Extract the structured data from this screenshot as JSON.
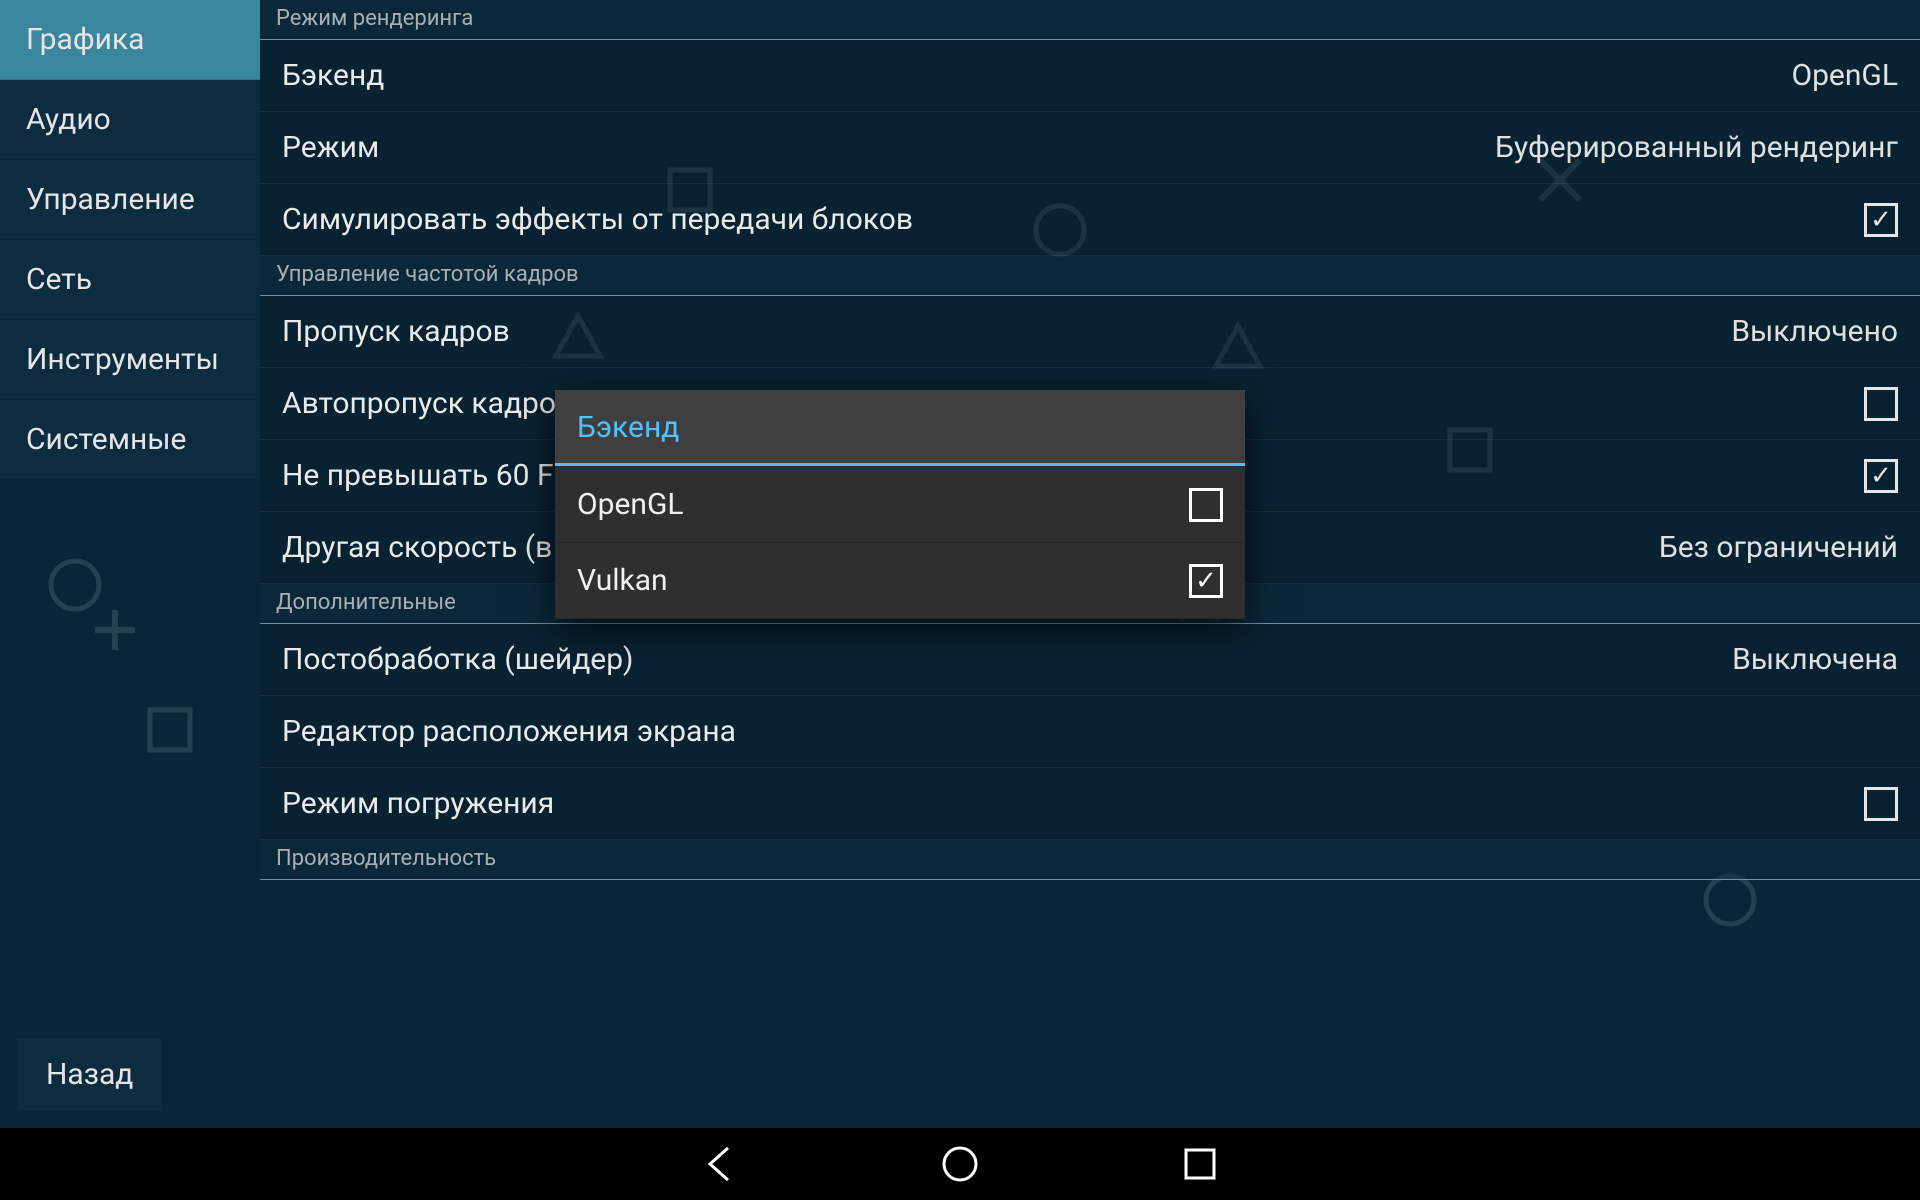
{
  "sidebar": {
    "items": [
      {
        "label": "Графика",
        "active": true
      },
      {
        "label": "Аудио"
      },
      {
        "label": "Управление"
      },
      {
        "label": "Сеть"
      },
      {
        "label": "Инструменты"
      },
      {
        "label": "Системные"
      }
    ],
    "back": "Назад"
  },
  "sections": {
    "render": {
      "header": "Режим рендеринга",
      "backend": {
        "label": "Бэкенд",
        "value": "OpenGL"
      },
      "mode": {
        "label": "Режим",
        "value": "Буферированный рендеринг"
      },
      "simulate": {
        "label": "Симулировать эффекты от передачи блоков",
        "checked": true
      }
    },
    "framerate": {
      "header": "Управление частотой кадров",
      "frameskip": {
        "label": "Пропуск кадров",
        "value": "Выключено"
      },
      "autoskip": {
        "label": "Автопропуск кадро",
        "checked": false
      },
      "cap60": {
        "label": "Не превышать 60 F",
        "checked": true
      },
      "altspeed": {
        "label": "Другая скорость (в",
        "value": "Без ограничений"
      }
    },
    "extra": {
      "header": "Дополнительные",
      "postproc": {
        "label": "Постобработка (шейдер)",
        "value": "Выключена"
      },
      "layout": {
        "label": "Редактор расположения экрана"
      },
      "immersive": {
        "label": "Режим погружения",
        "checked": false
      }
    },
    "perf": {
      "header": "Производительность"
    }
  },
  "dialog": {
    "title": "Бэкенд",
    "options": [
      {
        "label": "OpenGL",
        "checked": false
      },
      {
        "label": "Vulkan",
        "checked": true
      }
    ]
  },
  "nav": {
    "back": "back",
    "home": "home",
    "recent": "recent"
  }
}
